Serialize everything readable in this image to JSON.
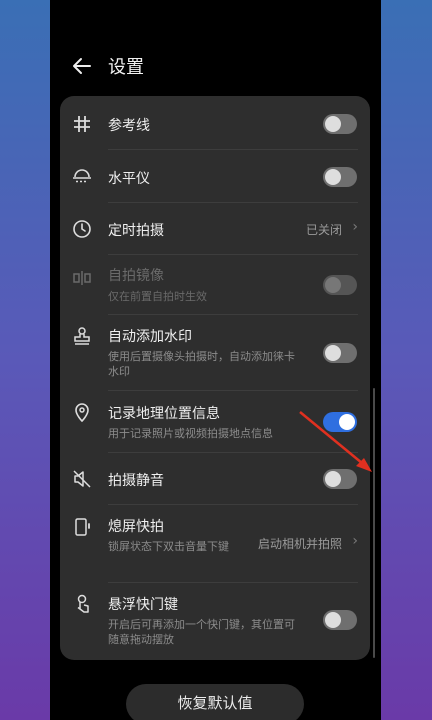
{
  "header": {
    "title": "设置"
  },
  "rows": [
    {
      "label": "参考线",
      "icon": "hash-icon",
      "toggle": "off"
    },
    {
      "label": "水平仪",
      "icon": "level-icon",
      "toggle": "off"
    },
    {
      "label": "定时拍摄",
      "icon": "timer-icon",
      "value": "已关闭"
    },
    {
      "label": "自拍镜像",
      "sub": "仅在前置自拍时生效",
      "icon": "mirror-icon",
      "toggle": "off",
      "disabled": true
    },
    {
      "label": "自动添加水印",
      "sub": "使用后置摄像头拍摄时，自动添加徕卡水印",
      "icon": "stamp-icon",
      "toggle": "off"
    },
    {
      "label": "记录地理位置信息",
      "sub": "用于记录照片或视频拍摄地点信息",
      "icon": "location-icon",
      "toggle": "on"
    },
    {
      "label": "拍摄静音",
      "icon": "mute-icon",
      "toggle": "off"
    },
    {
      "label": "熄屏快拍",
      "sub": "锁屏状态下双击音量下键",
      "icon": "screen-off-icon",
      "value": "启动相机并拍照"
    },
    {
      "label": "悬浮快门键",
      "sub": "开启后可再添加一个快门键，其位置可随意拖动摆放",
      "icon": "floating-shutter-icon",
      "toggle": "off"
    }
  ],
  "footer": {
    "reset_label": "恢复默认值"
  },
  "colors": {
    "accent": "#2f6fe0",
    "annotation_arrow": "#e03020"
  }
}
